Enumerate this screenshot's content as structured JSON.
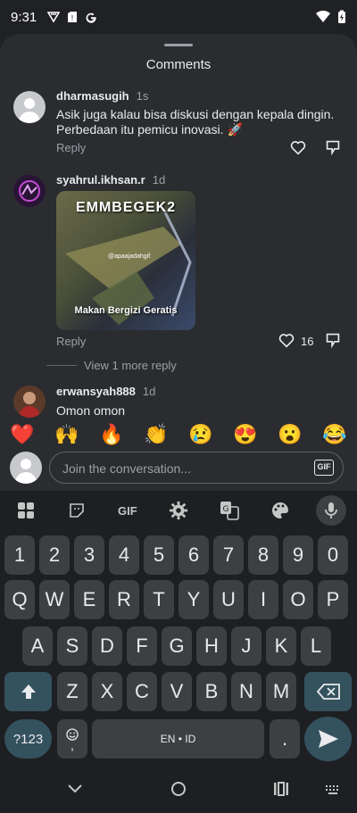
{
  "status": {
    "time": "9:31"
  },
  "sheet": {
    "title": "Comments"
  },
  "comments": [
    {
      "user": "dharmasugih",
      "time": "1s",
      "text": "Asik juga kalau bisa diskusi dengan kepala dingin. Perbedaan itu pemicu inovasi. 🚀",
      "reply": "Reply"
    },
    {
      "user": "syahrul.ikhsan.r",
      "time": "1d",
      "reply": "Reply",
      "likes": "16",
      "gif": {
        "top": "EMMBEGEK2",
        "watermark": "@apaajadahgif",
        "bottom": "Makan Bergizi Geratis"
      }
    },
    {
      "user": "erwansyah888",
      "time": "1d",
      "text": "Omon omon"
    }
  ],
  "view_more": "View 1 more reply",
  "emojis": [
    "❤️",
    "🙌",
    "🔥",
    "👏",
    "😢",
    "😍",
    "😮",
    "😂"
  ],
  "composer": {
    "placeholder": "Join the conversation...",
    "gif_label": "GIF"
  },
  "keyboard": {
    "gif_tool": "GIF",
    "row_numbers": [
      "1",
      "2",
      "3",
      "4",
      "5",
      "6",
      "7",
      "8",
      "9",
      "0"
    ],
    "row_q": [
      "Q",
      "W",
      "E",
      "R",
      "T",
      "Y",
      "U",
      "I",
      "O",
      "P"
    ],
    "row_a": [
      "A",
      "S",
      "D",
      "F",
      "G",
      "H",
      "J",
      "K",
      "L"
    ],
    "row_z": [
      "Z",
      "X",
      "C",
      "V",
      "B",
      "N",
      "M"
    ],
    "symbols_label": "?123",
    "space_label": "EN • ID",
    "period_label": "."
  }
}
